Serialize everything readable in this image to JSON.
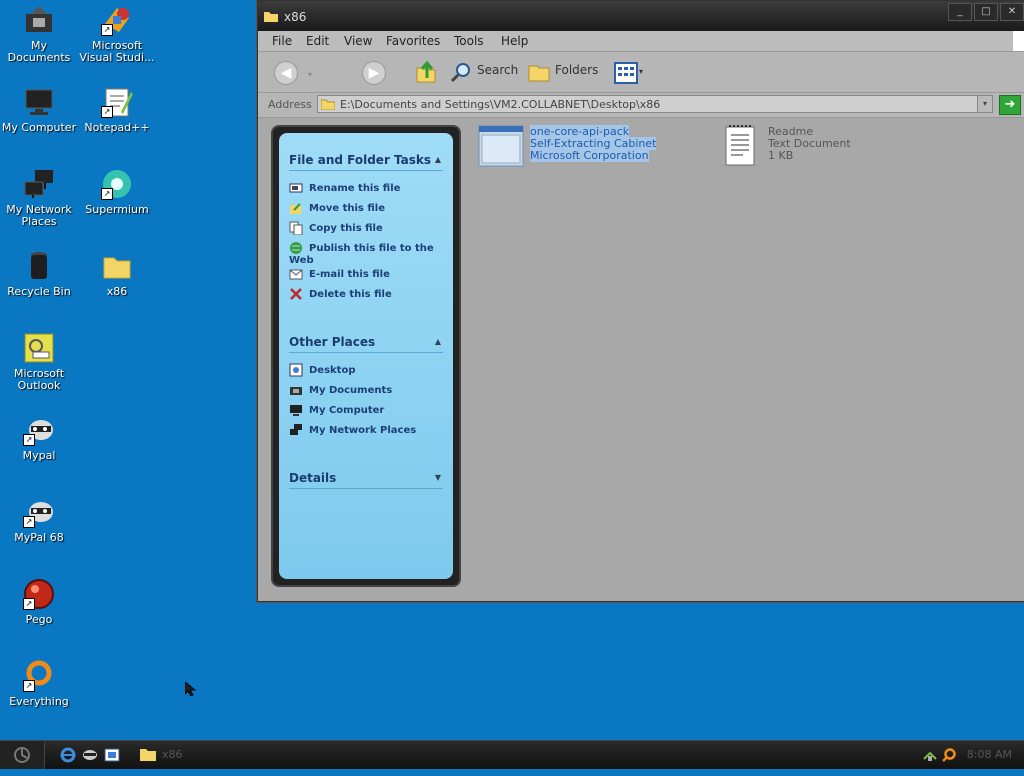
{
  "desktop": {
    "icons": [
      {
        "label": "My Documents"
      },
      {
        "label": "Microsoft Visual Studi..."
      },
      {
        "label": "My Computer"
      },
      {
        "label": "Notepad++"
      },
      {
        "label": "My Network Places"
      },
      {
        "label": "Supermium"
      },
      {
        "label": "Recycle Bin"
      },
      {
        "label": "x86"
      },
      {
        "label": "Microsoft Outlook"
      },
      {
        "label": "Mypal"
      },
      {
        "label": "MyPal 68"
      },
      {
        "label": "Pego"
      },
      {
        "label": "Everything"
      }
    ]
  },
  "window": {
    "title": "x86",
    "menu": [
      "File",
      "Edit",
      "View",
      "Favorites",
      "Tools",
      "Help"
    ],
    "toolbar": {
      "search": "Search",
      "folders": "Folders"
    },
    "address": {
      "label": "Address",
      "value": "E:\\Documents and Settings\\VM2.COLLABNET\\Desktop\\x86"
    },
    "task_pane": {
      "file_tasks_title": "File and Folder Tasks",
      "file_tasks": [
        "Rename this file",
        "Move this file",
        "Copy this file",
        "Publish this file to the Web",
        "E-mail this file",
        "Delete this file"
      ],
      "other_places_title": "Other Places",
      "other_places": [
        "Desktop",
        "My Documents",
        "My Computer",
        "My Network Places"
      ],
      "details_title": "Details"
    },
    "files": [
      {
        "name": "one-core-api-pack",
        "type": "Self-Extracting Cabinet",
        "info": "Microsoft Corporation"
      },
      {
        "name": "Readme",
        "type": "Text Document",
        "info": "1 KB"
      }
    ]
  },
  "taskbar": {
    "task_label": "x86",
    "clock": "8:08 AM"
  },
  "colors": {
    "desktop_bg": "#0a77c2",
    "selection": "#a5c6e6"
  }
}
